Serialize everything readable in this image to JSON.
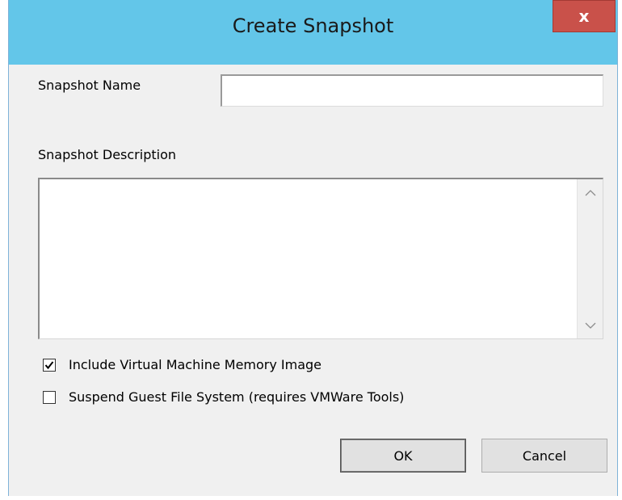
{
  "window": {
    "title": "Create Snapshot",
    "close_glyph": "x"
  },
  "form": {
    "name_label": "Snapshot Name",
    "name_value": "",
    "description_label": "Snapshot Description",
    "description_value": "",
    "options": [
      {
        "label": "Include Virtual Machine Memory Image",
        "checked": true
      },
      {
        "label": "Suspend Guest File System (requires VMWare Tools)",
        "checked": false
      }
    ]
  },
  "buttons": {
    "ok_label": "OK",
    "cancel_label": "Cancel"
  },
  "icons": {
    "close": "close-icon",
    "scroll_up": "chevron-up-icon",
    "scroll_down": "chevron-down-icon",
    "check": "checkmark-icon"
  },
  "colors": {
    "titlebar": "#63c6e9",
    "close_button": "#c9514a",
    "dialog_background": "#f0f0f0"
  }
}
